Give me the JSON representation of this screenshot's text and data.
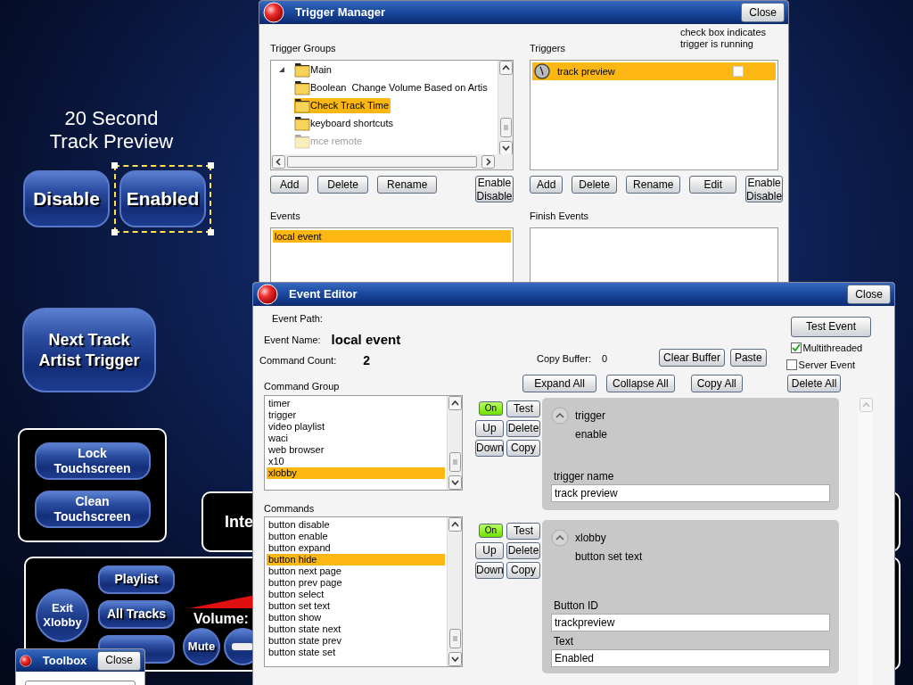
{
  "canvas": {
    "title": "20 Second Track Preview",
    "state_buttons": [
      {
        "label": "Disable",
        "selected": false
      },
      {
        "label": "Enabled",
        "selected": true
      }
    ],
    "next_track_button": "Next Track Artist Trigger",
    "touchscreen_buttons": [
      "Lock Touchscreen",
      "Clean Touchscreen"
    ],
    "info_panel_text": "Inte",
    "exit_button": "Exit Xlobby",
    "player_buttons": [
      "Playlist",
      "All Tracks"
    ],
    "volume_label": "Volume:",
    "mute_button": "Mute"
  },
  "toolbox": {
    "title": "Toolbox",
    "close": "Close"
  },
  "trigger_manager": {
    "title": "Trigger Manager",
    "close": "Close",
    "groups_label": "Trigger Groups",
    "tree": [
      {
        "label": "Main",
        "expanded": true,
        "selected": false,
        "disabled": false,
        "children": [
          {
            "label": "Boolean  Change Volume Based on Artis",
            "selected": false,
            "disabled": false
          },
          {
            "label": "Check Track Time",
            "selected": true,
            "disabled": false
          },
          {
            "label": "keyboard shortcuts",
            "selected": false,
            "disabled": false
          },
          {
            "label": "mce remote",
            "selected": false,
            "disabled": true
          }
        ]
      }
    ],
    "triggers_label": "Triggers",
    "note": "check box indicates trigger is running",
    "triggers": [
      {
        "label": "track preview",
        "selected": true,
        "running": false
      }
    ],
    "group_buttons": [
      "Add",
      "Delete",
      "Rename",
      "Enable Disable"
    ],
    "trigger_buttons": [
      "Add",
      "Delete",
      "Rename",
      "Edit",
      "Enable Disable"
    ],
    "events_label": "Events",
    "events": [
      {
        "label": "local event",
        "selected": true
      }
    ],
    "finish_events_label": "Finish Events"
  },
  "event_editor": {
    "title": "Event Editor",
    "close": "Close",
    "event_path_label": "Event Path:",
    "event_name_label": "Event Name:",
    "event_name": "local event",
    "command_count_label": "Command Count:",
    "command_count": "2",
    "test_event": "Test Event",
    "options": [
      {
        "label": "Multithreaded",
        "checked": true
      },
      {
        "label": "Server Event",
        "checked": false
      }
    ],
    "copy_buffer_label": "Copy Buffer:",
    "copy_buffer_value": "0",
    "buffer_buttons": [
      "Clear Buffer",
      "Paste"
    ],
    "bulk_buttons": [
      "Expand All",
      "Collapse All",
      "Copy All"
    ],
    "delete_all": "Delete All",
    "command_group_label": "Command Group",
    "command_groups": [
      {
        "label": "timer",
        "selected": false
      },
      {
        "label": "trigger",
        "selected": false
      },
      {
        "label": "video playlist",
        "selected": false
      },
      {
        "label": "waci",
        "selected": false
      },
      {
        "label": "web browser",
        "selected": false
      },
      {
        "label": "x10",
        "selected": false
      },
      {
        "label": "xlobby",
        "selected": true
      }
    ],
    "commands_label": "Commands",
    "commands": [
      {
        "label": "button disable",
        "selected": false
      },
      {
        "label": "button enable",
        "selected": false
      },
      {
        "label": "button expand",
        "selected": false
      },
      {
        "label": "button hide",
        "selected": true
      },
      {
        "label": "button next page",
        "selected": false
      },
      {
        "label": "button prev page",
        "selected": false
      },
      {
        "label": "button select",
        "selected": false
      },
      {
        "label": "button set text",
        "selected": false
      },
      {
        "label": "button show",
        "selected": false
      },
      {
        "label": "button state next",
        "selected": false
      },
      {
        "label": "button state prev",
        "selected": false
      },
      {
        "label": "button state set",
        "selected": false
      }
    ],
    "steps": [
      {
        "on": true,
        "buttons": [
          "On",
          "Test",
          "Up",
          "Delete",
          "Down",
          "Copy"
        ],
        "group": "trigger",
        "command": "enable",
        "fields": [
          {
            "label": "trigger name",
            "value": "track preview"
          }
        ]
      },
      {
        "on": true,
        "buttons": [
          "On",
          "Test",
          "Up",
          "Delete",
          "Down",
          "Copy"
        ],
        "group": "xlobby",
        "command": "button set text",
        "fields": [
          {
            "label": "Button ID",
            "value": "trackpreview"
          },
          {
            "label": "Text",
            "value": "Enabled"
          }
        ]
      }
    ]
  }
}
